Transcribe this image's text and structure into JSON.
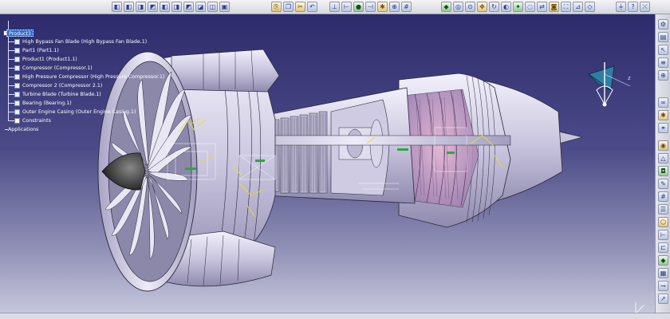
{
  "toolbar_top": {
    "groups": [
      {
        "name": "view-tools",
        "icons": [
          "cube-icon",
          "cube-icon",
          "cube-icon",
          "cube-icon",
          "cube-icon",
          "cube-icon",
          "cube-icon",
          "cube-icon",
          "cube-icon",
          "cube-icon"
        ]
      },
      {
        "name": "edit-tools",
        "icons": [
          "paste-icon",
          "copy-icon",
          "cut-icon",
          "undo-icon"
        ]
      },
      {
        "name": "analysis-tools",
        "icons": [
          "axis-icon",
          "measure-icon",
          "sphere-icon",
          "constraint-icon",
          "clash-icon",
          "snap-icon",
          "grid-icon"
        ]
      },
      {
        "name": "render-tools",
        "icons": [
          "fly-icon",
          "walk-icon",
          "zoom-icon",
          "pan-icon",
          "rotate-icon",
          "shade-icon",
          "light-icon",
          "hide-icon",
          "swap-icon",
          "cam-icon",
          "fit-icon",
          "normal-icon",
          "iso-icon"
        ]
      },
      {
        "name": "misc-tools",
        "icons": [
          "plug-icon",
          "help-icon",
          "exit-icon"
        ]
      }
    ]
  },
  "spec_tree": {
    "root": "Product3",
    "items": [
      "High Bypass Fan Blade (High Bypass Fan Blade.1)",
      "Part1 (Part1.1)",
      "Product1 (Product1.1)",
      "Compressor (Compressor.1)",
      "High Pressure Compressor (High Pressure Compressor.1)",
      "Compressor 2 (Compressor 2.1)",
      "Turbine Blade (Turbine Blade.1)",
      "Bearing (Bearing.1)",
      "Outer Engine Casing (Outer Engine Casing.1)",
      "Constraints",
      "Applications"
    ]
  },
  "right_toolbar": {
    "icons": [
      "wrench-icon",
      "doc-icon",
      "pointer-icon",
      "stack-icon",
      "snap-icon",
      "chain-icon",
      "gear-icon",
      "link-icon",
      "bolt-icon",
      "triangle-icon",
      "cube-icon",
      "brush-icon",
      "grid-icon",
      "layer-icon",
      "nut-icon",
      "ruler-icon",
      "clamp-icon",
      "part-icon",
      "assembly-icon",
      "pin-icon",
      "arrow-icon",
      "blade-icon",
      "render-icon",
      "settings-icon",
      "end-icon"
    ]
  },
  "model": {
    "name": "turbofan-engine-assembly",
    "colors": {
      "metal": "#d7d4ea",
      "metal_dark": "#8e8aaa",
      "edge": "#2a2838",
      "constraint": "#e6e02a",
      "constraint_green": "#2ca83c",
      "accent_pink": "#c56fa6",
      "background_top": "#2d2b6b",
      "background_bottom": "#c6c7dc"
    }
  },
  "compass": {
    "axis_label": "z"
  }
}
